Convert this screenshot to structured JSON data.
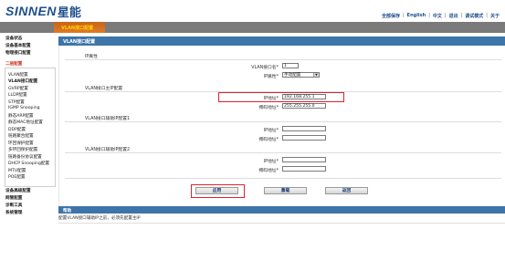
{
  "header": {
    "logo_en": "SINNEN",
    "logo_cn": "星能",
    "links": [
      "全部保存",
      "English",
      "中文",
      "退出",
      "调试模式",
      "关于"
    ]
  },
  "topbar": {
    "title": "VLAN接口配置"
  },
  "sidebar": {
    "items": [
      {
        "label": "设备状态"
      },
      {
        "label": "设备基本配置"
      },
      {
        "label": "物理接口配置"
      },
      {
        "label": "二层配置"
      }
    ],
    "subitems": [
      "VLAN配置",
      "VLAN接口配置",
      "GVRP配置",
      "LLDP配置",
      "STP配置",
      "IGMP Snooping",
      "静态ARP配置",
      "静态MAC地址配置",
      "DDP配置",
      "链路聚合配置",
      "环回保护配置",
      "多环回保护配置",
      "链路备份协议配置",
      "DHCP Snooping配置",
      "MTU配置",
      "POE配置"
    ],
    "bottom_items": [
      {
        "label": "设备高级配置"
      },
      {
        "label": "网管配置"
      },
      {
        "label": "诊断工具"
      },
      {
        "label": "系统管理"
      }
    ]
  },
  "main": {
    "title": "VLAN接口配置",
    "section_ip_attr": "IP属性",
    "vlan_if_name_label": "VLAN接口名*",
    "vlan_if_name_value": "1",
    "ip_attr_label": "IP属性*",
    "ip_attr_value": "手动配置",
    "section_main_ip": "VLAN接口主IP配置",
    "ip_label": "IP地址*",
    "ip_value": "192.168.255.1",
    "mask_label": "掩码地址*",
    "mask_value": "255.255.255.0",
    "section_aux1": "VLAN接口辅助IP配置1",
    "aux1_ip_label": "IP地址*",
    "aux1_mask_label": "掩码地址*",
    "section_aux2": "VLAN接口辅助IP配置2",
    "aux2_ip_label": "IP地址*",
    "aux2_mask_label": "掩码地址*",
    "buttons": {
      "apply": "应用",
      "reset": "重载",
      "back": "返回"
    }
  },
  "help": {
    "title": "帮助",
    "text": "配置VLAN接口辅助IP之前，必须先配置主IP"
  },
  "colors": {
    "highlight": "#d9232e",
    "header_blue": "#3d74a9",
    "accent_orange": "#e07a22"
  }
}
